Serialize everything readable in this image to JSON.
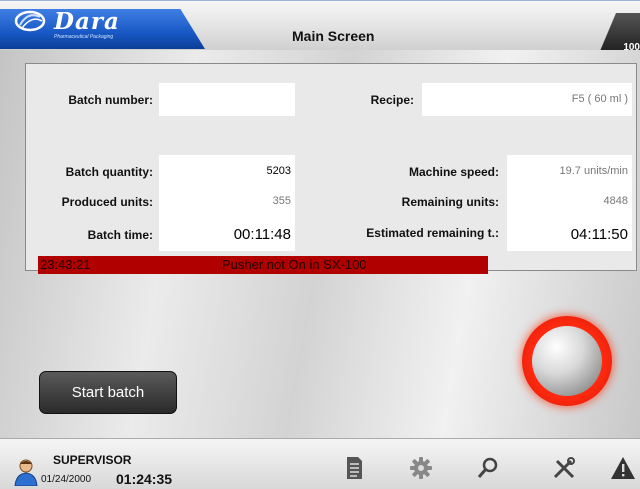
{
  "header": {
    "logo_text": "Dara",
    "logo_subtitle": "Pharmaceutical Packaging",
    "title": "Main Screen",
    "right_tab_text": "100"
  },
  "fields": {
    "batch_number": {
      "label": "Batch number:",
      "value": ""
    },
    "batch_quantity": {
      "label": "Batch quantity:",
      "value": "5203"
    },
    "produced_units": {
      "label": "Produced units:",
      "value": "355"
    },
    "batch_time": {
      "label": "Batch time:",
      "value": "00:11:48"
    },
    "recipe": {
      "label": "Recipe:",
      "value": "F5 ( 60 ml )"
    },
    "machine_speed": {
      "label": "Machine speed:",
      "value": "19.7 units/min"
    },
    "remaining_units": {
      "label": "Remaining units:",
      "value": "4848"
    },
    "estimated_remaining": {
      "label": "Estimated remaining t.:",
      "value": "04:11:50"
    }
  },
  "alarm": {
    "time": "23:43:21",
    "message": "Pusher not On in SX-100",
    "color": "#b00000"
  },
  "start_button": {
    "label": "Start batch"
  },
  "round_button": {
    "icon": "red-ring-button",
    "color": "#ff2a10"
  },
  "footer": {
    "user_role": "SUPERVISOR",
    "date": "01/24/2000",
    "time": "01:24:35",
    "icons": [
      "document-icon",
      "gear-icon",
      "search-icon",
      "tools-icon",
      "warning-icon"
    ]
  }
}
